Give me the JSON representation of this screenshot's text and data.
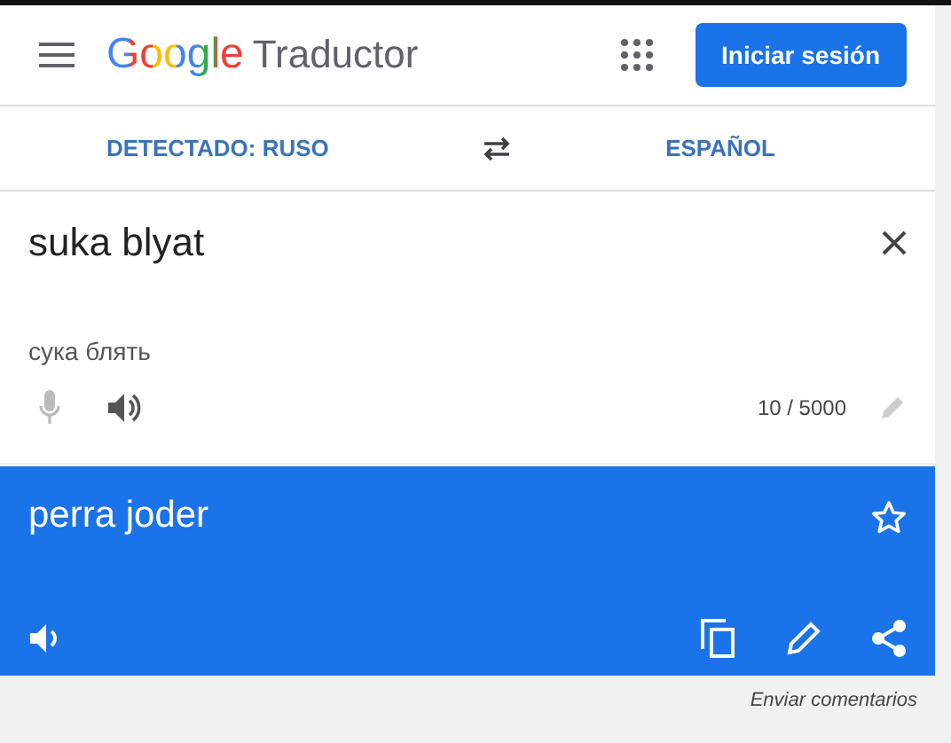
{
  "header": {
    "logo": "Google",
    "product": "Traductor",
    "sign_in": "Iniciar sesión"
  },
  "languages": {
    "source": "DETECTADO: RUSO",
    "target": "ESPAÑOL"
  },
  "input": {
    "value": "suka blyat",
    "transliteration": "сука блять",
    "counter": "10 / 5000"
  },
  "output": {
    "text": "perra joder"
  },
  "footer": {
    "feedback": "Enviar comentarios"
  }
}
